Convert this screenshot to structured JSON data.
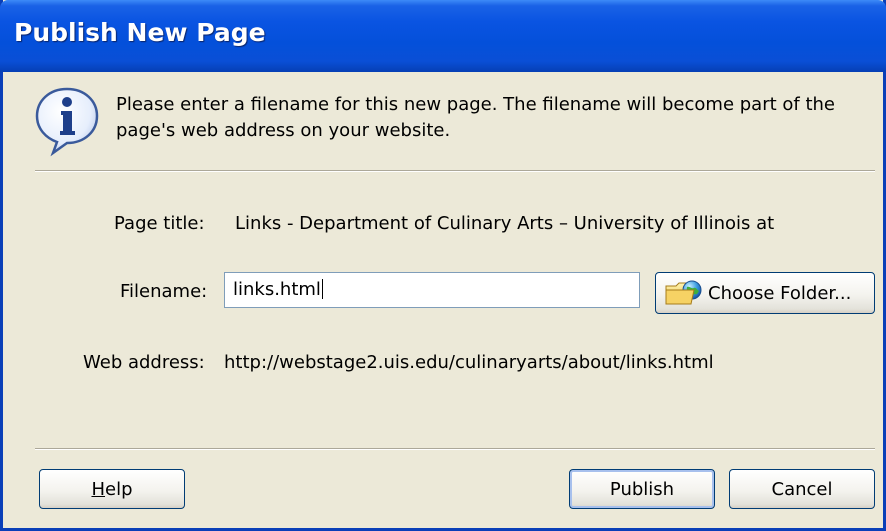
{
  "window": {
    "title": "Publish New Page"
  },
  "message": "Please enter a filename for this new page. The filename will become part of the page's web address on your website.",
  "page_title": {
    "label": "Page title:",
    "value": "Links - Department of Culinary Arts – University of Illinois at"
  },
  "filename": {
    "label": "Filename:",
    "value": "links.html"
  },
  "choose_folder": {
    "label": "Choose Folder..."
  },
  "web_address": {
    "label": "Web address:",
    "value": "http://webstage2.uis.edu/culinaryarts/about/links.html"
  },
  "buttons": {
    "help_first": "H",
    "help_rest": "elp",
    "publish": "Publish",
    "cancel": "Cancel"
  },
  "icons": {
    "info": "info-icon",
    "folder": "folder-globe-icon"
  },
  "colors": {
    "titlebar": "#0450da",
    "dialog_bg": "#ece9d8",
    "button_border": "#003c74"
  }
}
